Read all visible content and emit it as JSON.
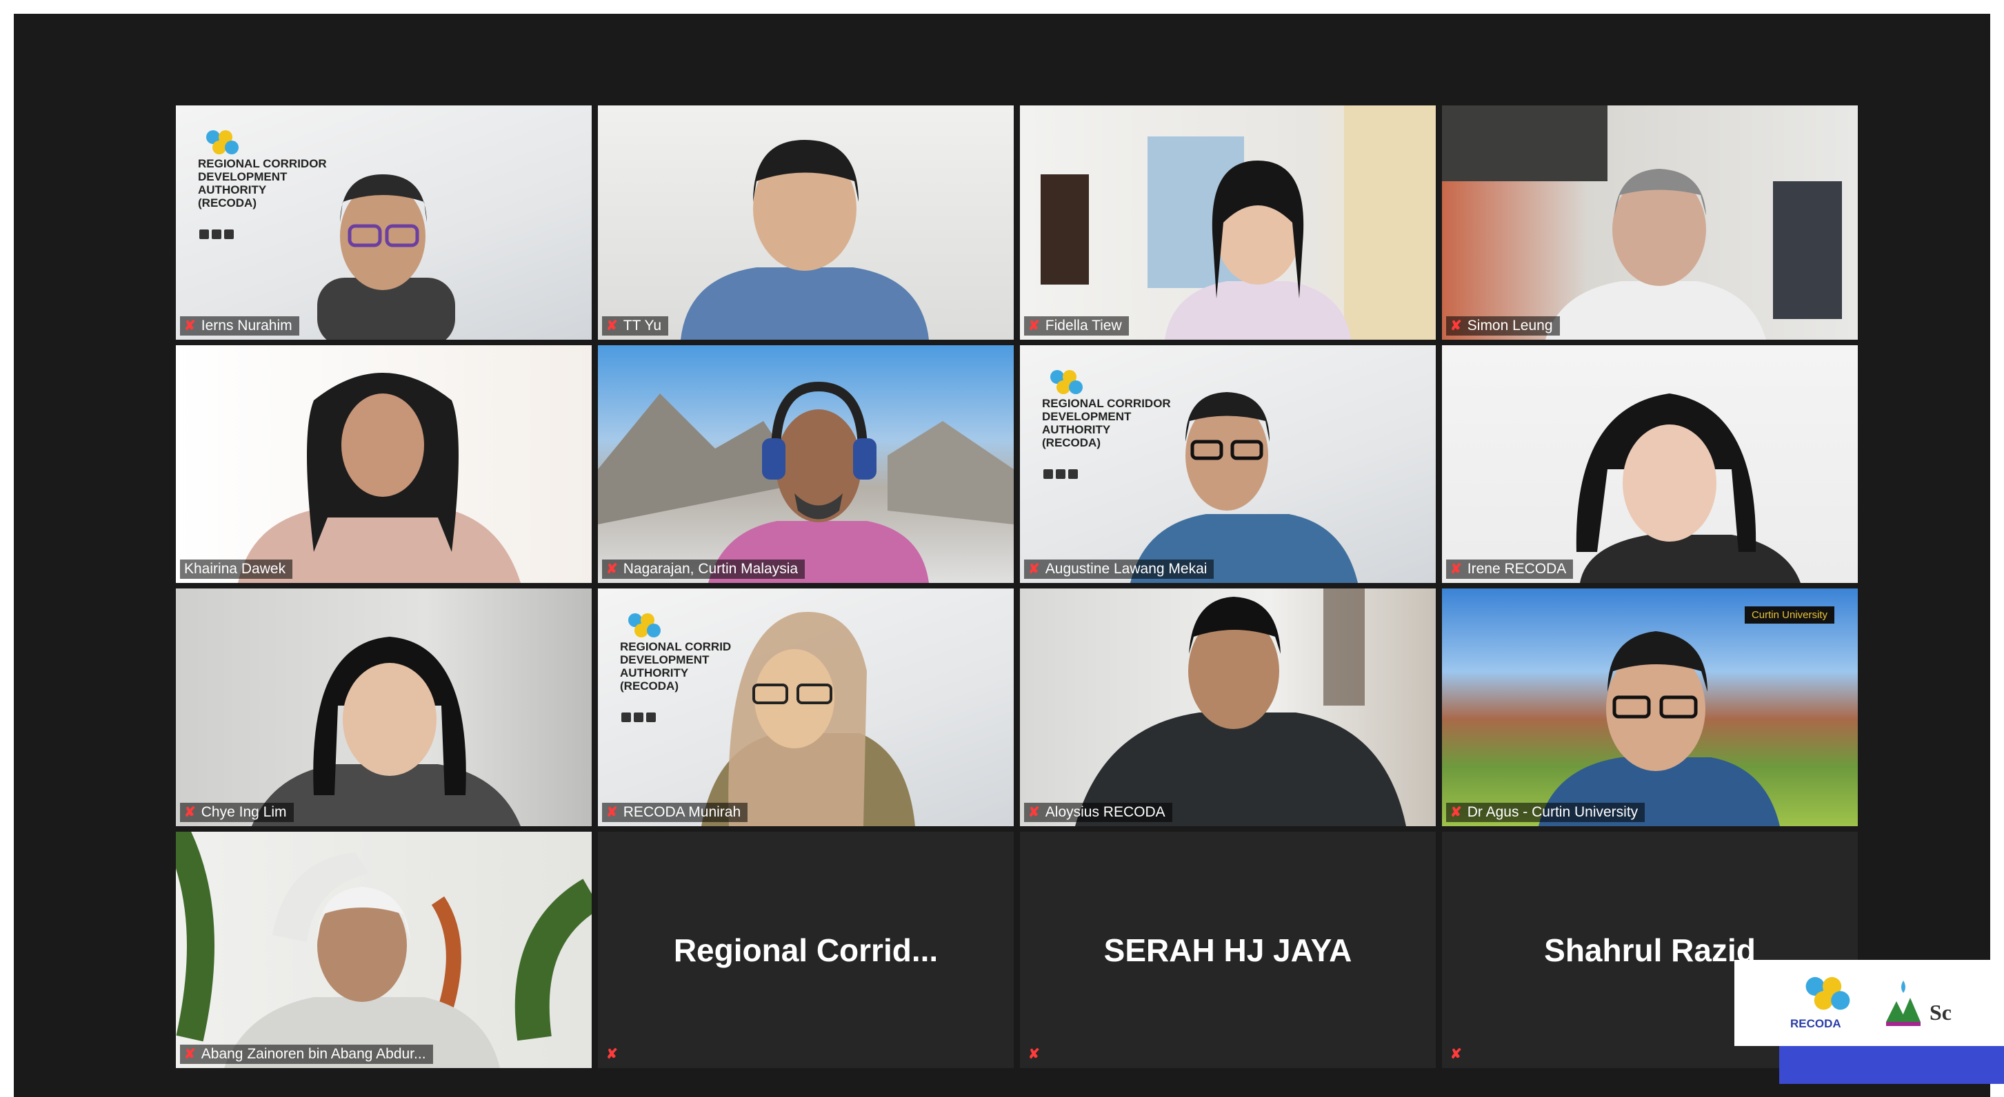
{
  "participants": [
    {
      "name": "Ierns Nurahim"
    },
    {
      "name": "TT Yu"
    },
    {
      "name": "Fidella Tiew"
    },
    {
      "name": "Simon Leung"
    },
    {
      "name": "Khairina Dawek"
    },
    {
      "name": "Nagarajan, Curtin Malaysia"
    },
    {
      "name": "Augustine Lawang Mekai"
    },
    {
      "name": "Irene RECODA"
    },
    {
      "name": "Chye Ing Lim"
    },
    {
      "name": "RECODA Munirah"
    },
    {
      "name": "Aloysius RECODA"
    },
    {
      "name": "Dr Agus - Curtin University"
    },
    {
      "name": "Abang Zainoren bin Abang Abdur..."
    },
    {
      "name": "Regional  Corrid..."
    },
    {
      "name": "SERAH HJ JAYA"
    },
    {
      "name": "Shahrul Razid"
    }
  ],
  "virtual_background": {
    "title_lines": [
      "REGIONAL CORRIDOR",
      "DEVELOPMENT",
      "AUTHORITY",
      "(RECODA)"
    ]
  },
  "tile3_bg_lines": [
    "REGIONAL CORRID",
    "DEVELOPMENT",
    "AUTHORITY",
    "(RECODA)"
  ],
  "banner_text": "Curtin University",
  "brand": {
    "logo_text": "RECODA",
    "secondary_text": "Sc"
  },
  "colors": {
    "background": "#1a1a1a",
    "active_border": "#e8f08a",
    "muted_mic": "#ff3b3b",
    "brand_stripe": "#3b4bd1"
  }
}
